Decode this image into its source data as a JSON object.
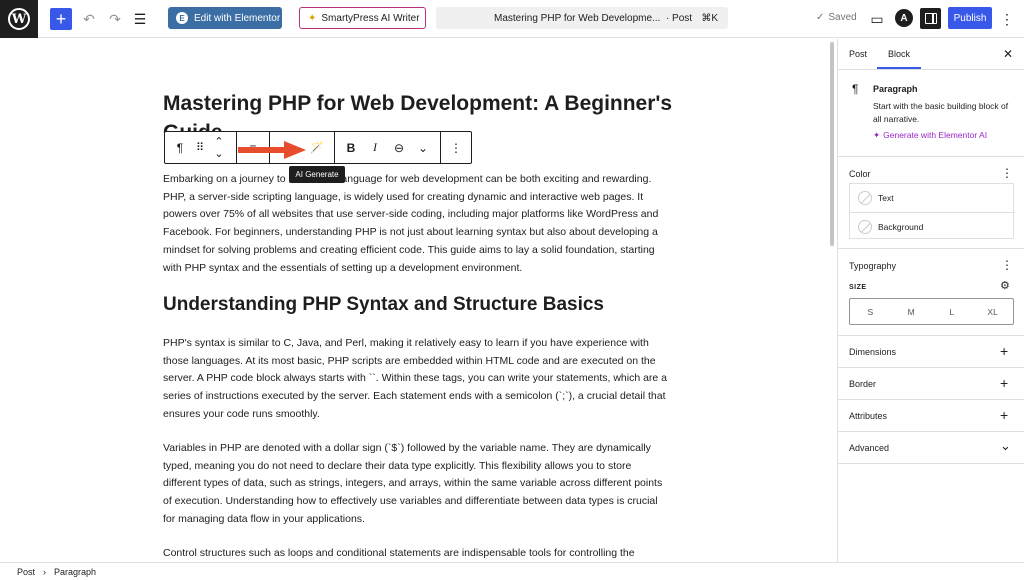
{
  "topbar": {
    "wp_logo": "W",
    "add_icon": "+",
    "undo_icon": "↶",
    "redo_icon": "↷",
    "listview_icon": "☰",
    "edit_elementor": "Edit with Elementor",
    "elementor_icon": "E",
    "smartypress": "SmartyPress AI Writer",
    "doc_title": "Mastering PHP for Web Developme...",
    "doc_type": "· Post",
    "shortcut": "⌘K",
    "saved": "Saved",
    "saved_check": "✓",
    "preview_icon": "▭",
    "astra_icon": "A",
    "publish": "Publish",
    "more_icon": "⋮"
  },
  "editor": {
    "title": "Mastering PHP for Web Development: A Beginner's Guide",
    "paragraph1": "Embarking on a journey to learn PHP language for web development can be both exciting and rewarding. PHP, a server-side scripting language, is widely used for creating dynamic and interactive web pages. It powers over 75% of all websites that use server-side coding, including major platforms like WordPress and Facebook. For beginners, understanding PHP is not just about learning syntax but also about developing a mindset for solving problems and creating efficient code. This guide aims to lay a solid foundation, starting with PHP syntax and the essentials of setting up a development environment.",
    "heading2": "Understanding PHP Syntax and Structure Basics",
    "paragraph2": "PHP's syntax is similar to C, Java, and Perl, making it relatively easy to learn if you have experience with those languages. At its most basic, PHP scripts are embedded within HTML code and are executed on the server. A PHP code block always starts with ``. Within these tags, you can write your statements, which are a series of instructions executed by the server. Each statement ends with a semicolon (`;`), a crucial detail that ensures your code runs smoothly.",
    "paragraph3": "Variables in PHP are denoted with a dollar sign (`$`) followed by the variable name. They are dynamically typed, meaning you do not need to declare their data type explicitly. This flexibility allows you to store different types of data, such as strings, integers, and arrays, within the same variable across different points of execution. Understanding how to effectively use variables and differentiate between data types is crucial for managing data flow in your applications.",
    "paragraph4": "Control structures such as loops and conditional statements are indispensable tools for controlling the"
  },
  "block_toolbar": {
    "paragraph_icon": "¶",
    "drag_icon": "⠿",
    "move_up_icon": "⌃",
    "move_down_icon": "⌄",
    "align_icon": "≡",
    "ai_wand_icon": "🪄",
    "bold": "B",
    "italic": "I",
    "link_icon": "⊖",
    "more_rich_icon": "⌄",
    "options_icon": "⋮",
    "tooltip": "AI Generate"
  },
  "sidebar": {
    "tab_post": "Post",
    "tab_block": "Block",
    "close_icon": "✕",
    "block_icon": "¶",
    "block_name": "Paragraph",
    "block_desc": "Start with the basic building block of all narrative.",
    "generate_link": "Generate with Elementor AI",
    "generate_icon": "✦",
    "color_title": "Color",
    "color_text": "Text",
    "color_background": "Background",
    "typography_title": "Typography",
    "size_label": "SIZE",
    "size_options": [
      "S",
      "M",
      "L",
      "XL"
    ],
    "size_ctrl_icon": "⚙",
    "dimensions": "Dimensions",
    "border": "Border",
    "attributes": "Attributes",
    "advanced": "Advanced",
    "dots_icon": "⋮",
    "plus_icon": "+",
    "chevron_icon": "⌄"
  },
  "footer": {
    "crumb1": "Post",
    "separator": "›",
    "crumb2": "Paragraph"
  },
  "colors": {
    "accent": "#3858e9",
    "elementor": "#3a6ea5",
    "smarty_border": "#b9307b",
    "ai_link": "#9a28c9",
    "arrow": "#e74c2c"
  }
}
